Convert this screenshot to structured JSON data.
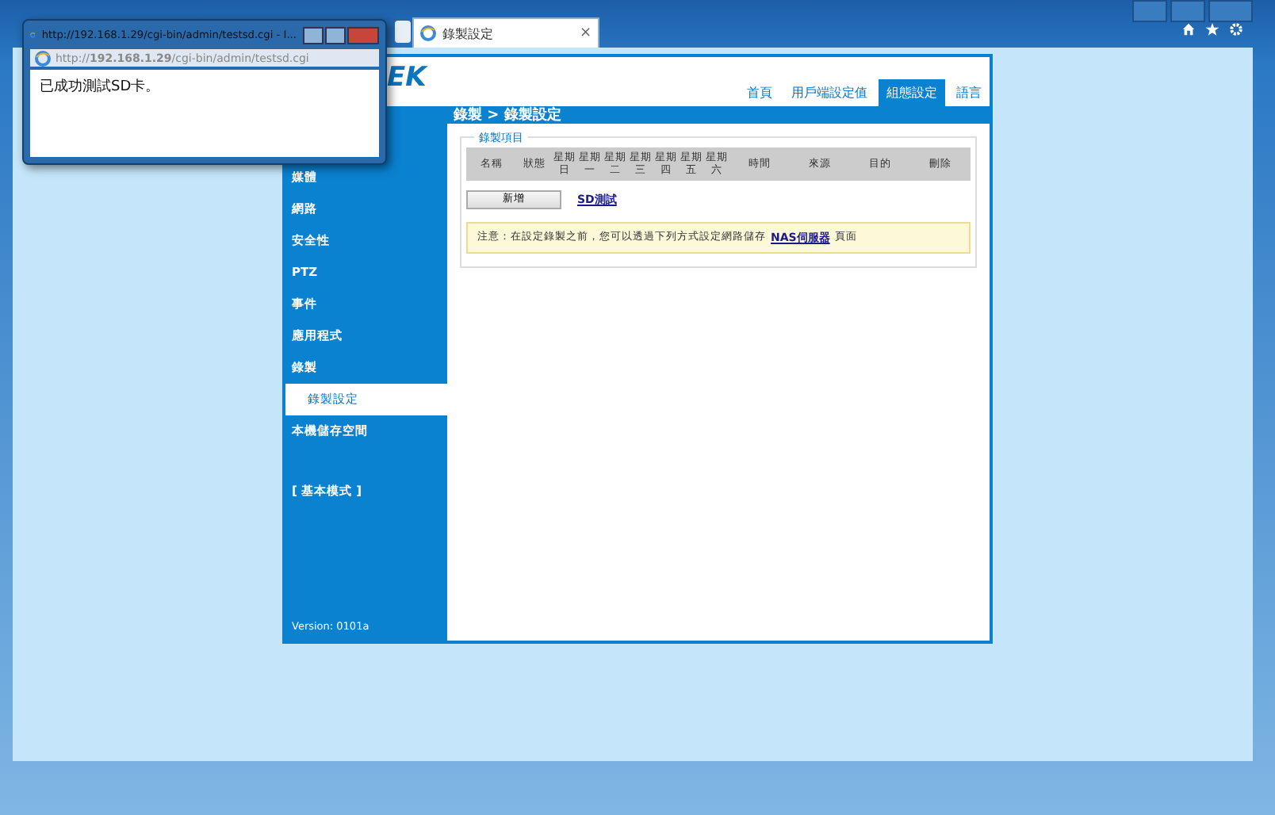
{
  "browser": {
    "tab": {
      "title": "錄製設定",
      "close": "×"
    }
  },
  "popup": {
    "title": "http://192.168.1.29/cgi-bin/admin/testsd.cgi - I...",
    "address": "http://**192.168.1.29**/cgi-bin/admin/testsd.cgi",
    "message": "已成功測試SD卡。"
  },
  "header": {
    "logo": "EK",
    "nav": [
      {
        "label": "首頁",
        "selected": false
      },
      {
        "label": "用戶端設定值",
        "selected": false
      },
      {
        "label": "組態設定",
        "selected": true
      },
      {
        "label": "語言",
        "selected": false
      }
    ]
  },
  "breadcrumb": "錄製 > 錄製設定",
  "sidebar": {
    "items": [
      {
        "label": "媒體",
        "selected": false
      },
      {
        "label": "網路",
        "selected": false
      },
      {
        "label": "安全性",
        "selected": false
      },
      {
        "label": "PTZ",
        "selected": false
      },
      {
        "label": "事件",
        "selected": false
      },
      {
        "label": "應用程式",
        "selected": false
      },
      {
        "label": "錄製",
        "selected": false,
        "children": [
          {
            "label": "錄製設定",
            "selected": true
          }
        ]
      },
      {
        "label": "本機儲存空間",
        "selected": false
      }
    ],
    "basic_mode": "[ 基本模式 ]",
    "version": "Version: 0101a"
  },
  "recording": {
    "legend": "錄製項目",
    "columns": [
      "名稱",
      "狀態",
      "星期日",
      "星期一",
      "星期二",
      "星期三",
      "星期四",
      "星期五",
      "星期六",
      "時間",
      "來源",
      "目的",
      "刪除"
    ],
    "add_button": "新增",
    "sd_test_link": "SD測試",
    "notice_text": "注意：在設定錄製之前，您可以透過下列方式設定網路儲存",
    "notice_link": "NAS伺服器",
    "notice_tail": "頁面"
  }
}
